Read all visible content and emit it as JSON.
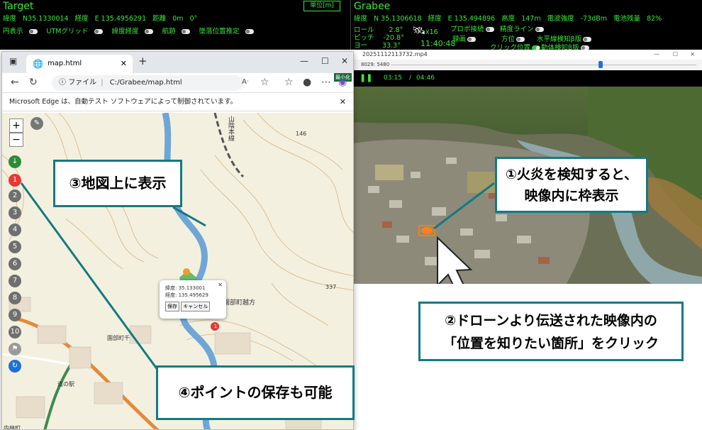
{
  "hud_left": {
    "title": "Target",
    "unit_button": "単位[m]",
    "lat_label": "緯度",
    "lat_value": "N35.1330014",
    "lon_label": "経度",
    "lon_value": "E 135.4956291",
    "dist_label": "距離",
    "dist_value": "0m",
    "angle_value": "0°",
    "toggles": [
      "円表示",
      "UTMグリッド",
      "緯度経度",
      "航跡",
      "墜落位置推定"
    ]
  },
  "hud_right": {
    "title": "Grabee",
    "lat_label": "緯度",
    "lat_value": "N  35.1306618",
    "lon_label": "経度",
    "lon_value": "E  135.494896",
    "alt_label": "高度",
    "alt_value": "147m",
    "signal_label": "電波強度",
    "signal_value": "-73dBm",
    "battery_label": "電池残量",
    "battery_value": "82%",
    "roll_label": "ロール",
    "roll_value": "2.8°",
    "pitch_label": "ピッチ",
    "pitch_value": "-20.8°",
    "yaw_label": "ヨー",
    "yaw_value": "33.3°",
    "sat_count": "x16",
    "clock": "11:40:48",
    "propo_label": "プロポ接続",
    "record_label": "録画",
    "precision_label": "精度ライン",
    "bearing_label": "方位",
    "click_pos_label": "クリック位置",
    "horizon_label": "水平線検知β版",
    "motion_label": "動体検知β版"
  },
  "browser": {
    "tab_title": "map.html",
    "url_prefix": "ファイル",
    "url": "C:/Grabee/map.html",
    "notice": "Microsoft Edge は、自動テスト ソフトウェアによって制御されています。",
    "ext_badge": "最小化"
  },
  "map": {
    "zoom_in": "+",
    "zoom_out": "−",
    "points": [
      "1",
      "2",
      "3",
      "4",
      "5",
      "6",
      "7",
      "8",
      "9",
      "10"
    ],
    "popup_lat": "緯度: 35.133001",
    "popup_lon": "経度: 135.495629",
    "popup_save": "保存",
    "popup_cancel": "キャンセル",
    "marker_label": "1",
    "label_sonobe_kita": "園部町越方",
    "label_sonobe_chisen": "園部町千",
    "label_uchibayashi": "内林町",
    "label_sanin": "山陰本線",
    "label_337": "337",
    "label_146": "146",
    "label_station": "道の駅"
  },
  "player": {
    "title": "20251112113732.mp4",
    "frame": "8029: 5480",
    "time_current": "03:15",
    "time_total": "04:46"
  },
  "callouts": {
    "c1_line1": "①火炎を検知すると、",
    "c1_line2": "映像内に枠表示",
    "c2_line1": "②ドローンより伝送された映像内の",
    "c2_line2": "「位置を知りたい箇所」をクリック",
    "c3": "③地図上に表示",
    "c4": "④ポイントの保存も可能"
  }
}
